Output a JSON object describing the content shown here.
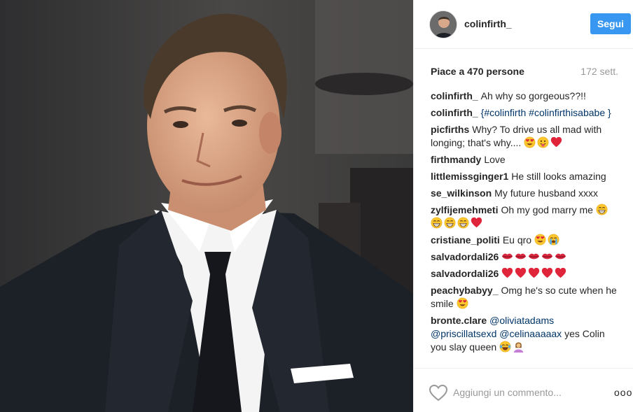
{
  "post": {
    "photo_alt": "",
    "colors": {
      "accent": "#3897f0",
      "link": "#003569",
      "muted": "#999999"
    }
  },
  "header": {
    "username": "colinfirth_",
    "follow_label": "Segui"
  },
  "meta": {
    "likes": "Piace a 470 persone",
    "age": "172 sett."
  },
  "comments": [
    {
      "user": "colinfirth_",
      "text": "Ah why so gorgeous??!!",
      "emojis": []
    },
    {
      "user": "colinfirth_",
      "text": "{#colinfirth #colinfirthisababe }",
      "link": true,
      "emojis": []
    },
    {
      "user": "picfirths",
      "text": "Why? To drive us all mad with longing; that's why....",
      "emojis": [
        "heart-eyes",
        "tongue",
        "red-heart"
      ]
    },
    {
      "user": "firthmandy",
      "text": "Love",
      "emojis": []
    },
    {
      "user": "littlemissginger1",
      "text": "He still looks amazing",
      "emojis": []
    },
    {
      "user": "se_wilkinson",
      "text": "My future husband xxxx",
      "emojis": []
    },
    {
      "user": "zylfijemehmeti",
      "text": "Oh my god marry me",
      "emojis": [
        "grin",
        "grin",
        "grin",
        "grin",
        "red-heart"
      ]
    },
    {
      "user": "cristiane_politi",
      "text": "Eu qro",
      "emojis": [
        "heart-eyes",
        "crying"
      ]
    },
    {
      "user": "salvadordali26",
      "text": "",
      "emojis": [
        "lips",
        "lips",
        "lips",
        "lips",
        "lips"
      ]
    },
    {
      "user": "salvadordali26",
      "text": "",
      "emojis": [
        "red-heart",
        "red-heart",
        "red-heart",
        "red-heart",
        "red-heart"
      ]
    },
    {
      "user": "peachybabyy_",
      "text": "Omg he's so cute when he smile",
      "emojis": [
        "heart-eyes"
      ]
    },
    {
      "user": "bronte.clare",
      "mentions": "@oliviatadams @priscillatsexd @celinaaaaax",
      "text": "yes Colin you slay queen",
      "emojis": [
        "joy",
        "raising-hands"
      ]
    },
    {
      "user": "...",
      "text": "",
      "emojis": []
    }
  ],
  "footer": {
    "comment_placeholder": "Aggiungi un commento...",
    "more_label": "ooo"
  }
}
